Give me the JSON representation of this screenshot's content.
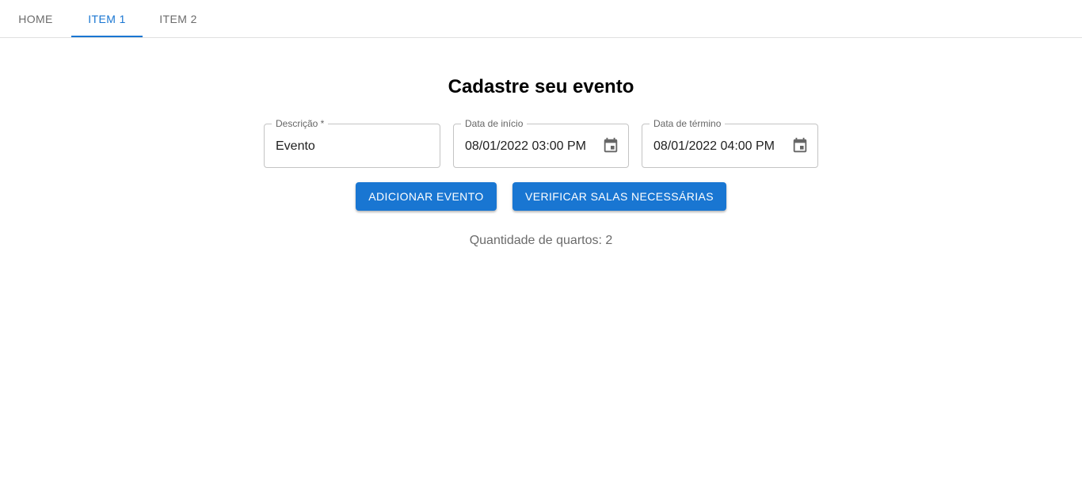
{
  "nav": {
    "tabs": [
      {
        "label": "HOME"
      },
      {
        "label": "ITEM 1",
        "active": true
      },
      {
        "label": "ITEM 2"
      }
    ]
  },
  "form": {
    "title": "Cadastre seu evento",
    "descricao": {
      "label": "Descrição *",
      "value": "Evento"
    },
    "data_inicio": {
      "label": "Data de início",
      "value": "08/01/2022 03:00 PM",
      "icon": "calendar-icon"
    },
    "data_termino": {
      "label": "Data de término",
      "value": "08/01/2022 04:00 PM",
      "icon": "calendar-icon"
    },
    "add_button": "ADICIONAR EVENTO",
    "verify_button": "VERIFICAR SALAS NECESSÁRIAS",
    "result_text": "Quantidade de quartos: 2"
  },
  "colors": {
    "primary": "#1976d2",
    "tab_inactive": "#6b6b6b",
    "border": "#c4c4c4"
  }
}
